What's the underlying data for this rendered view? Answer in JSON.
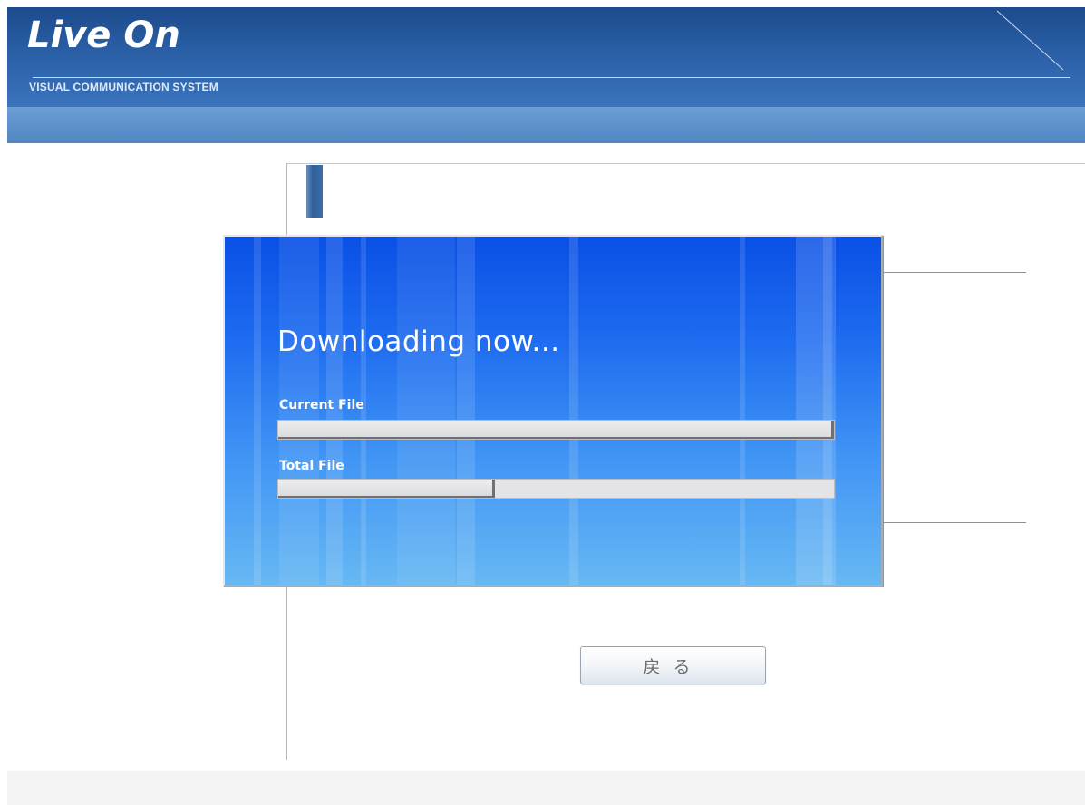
{
  "header": {
    "logo_text": "Live On",
    "tagline": "VISUAL COMMUNICATION SYSTEM"
  },
  "modal": {
    "title": "Downloading now...",
    "current_file_label": "Current File",
    "current_file_progress": 1.0,
    "total_file_label": "Total File",
    "total_file_progress": 0.39
  },
  "buttons": {
    "back_label": "戻る"
  },
  "colors": {
    "header_dark": "#1d4b8c",
    "subbar": "#5a8fca",
    "modal_top": "#0a50e6",
    "modal_bottom": "#67b8f3"
  }
}
